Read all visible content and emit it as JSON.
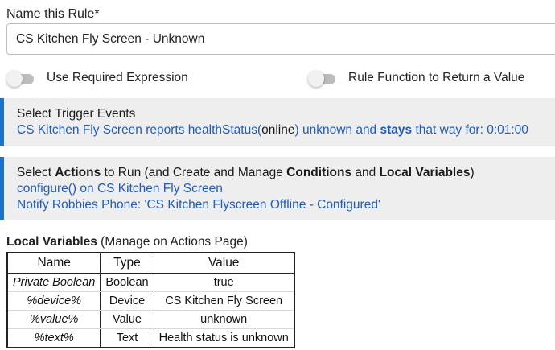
{
  "rule_name": {
    "label": "Name this Rule*",
    "value": "CS Kitchen Fly Screen - Unknown"
  },
  "toggles": [
    {
      "label": "Use Required Expression",
      "state": "off"
    },
    {
      "label": "Rule Function to Return a Value",
      "state": "off"
    }
  ],
  "trigger_section": {
    "title": "Select Trigger Events",
    "event": {
      "prefix": "CS Kitchen Fly Screen reports healthStatus(",
      "value": "online",
      "middle": ") unknown and ",
      "emphasis": "stays",
      "suffix": " that way for: 0:01:00"
    }
  },
  "actions_section": {
    "title_parts": {
      "p1": "Select ",
      "b1": "Actions",
      "p2": " to Run (and Create and Manage ",
      "b2": "Conditions",
      "p3": " and ",
      "b3": "Local Variables",
      "p4": ")"
    },
    "actions": [
      "configure() on CS Kitchen Fly Screen",
      "Notify Robbies Phone: 'CS Kitchen Flyscreen Offline - Configured'"
    ]
  },
  "local_variables": {
    "heading_bold": "Local Variables",
    "heading_note": " (Manage on Actions Page)",
    "columns": [
      "Name",
      "Type",
      "Value"
    ],
    "rows": [
      [
        "Private Boolean",
        "Boolean",
        "true"
      ],
      [
        "%device%",
        "Device",
        "CS Kitchen Fly Screen"
      ],
      [
        "%value%",
        "Value",
        "unknown"
      ],
      [
        "%text%",
        "Text",
        "Health status is unknown"
      ]
    ]
  },
  "colors": {
    "panel_accent": "#1a73c8",
    "panel_background": "#eeeeee",
    "link": "#1f5bb8",
    "toggle_track_off": "#bdbdbd"
  }
}
